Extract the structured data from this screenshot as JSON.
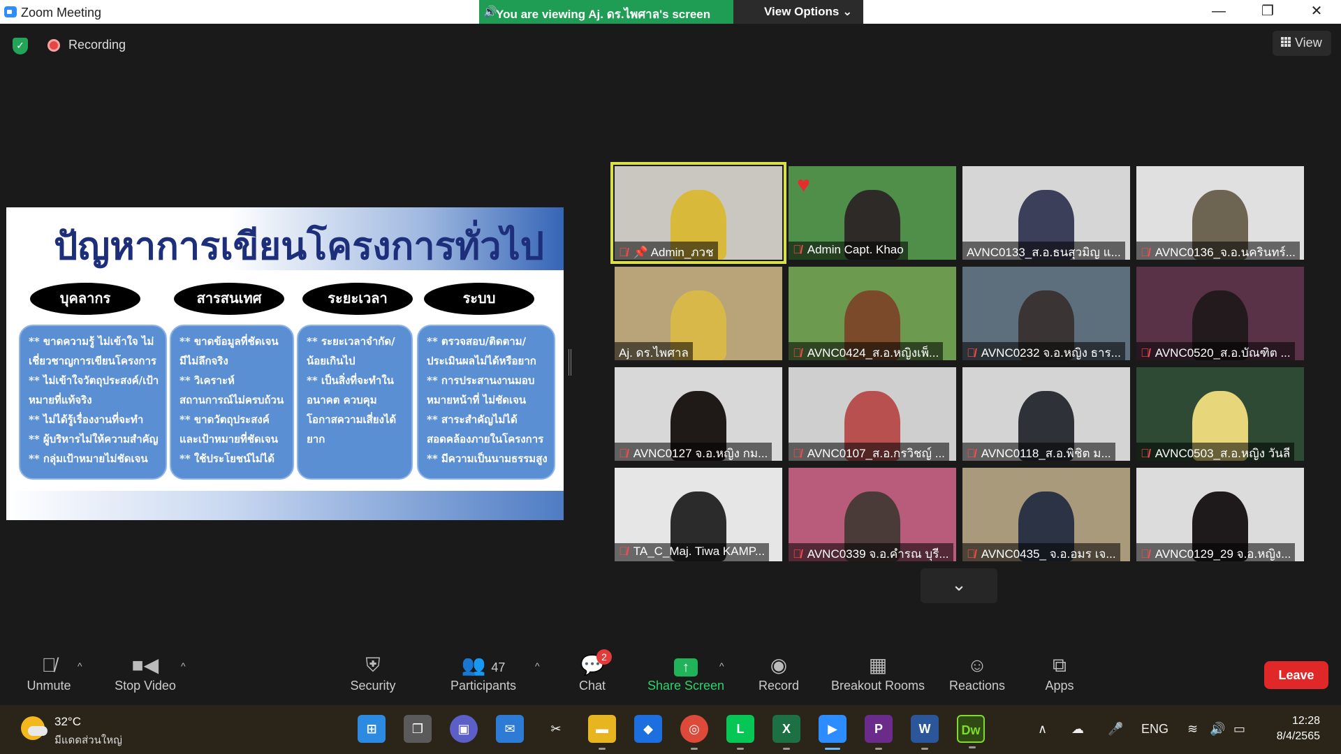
{
  "window": {
    "title": "Zoom Meeting",
    "minimize": "—",
    "maximize": "❐",
    "close": "✕"
  },
  "banner": {
    "viewing": "You are viewing Aj. ดร.ไพศาล's screen",
    "view_options": "View Options ⌄"
  },
  "meeting": {
    "recording_label": "Recording",
    "view_label": "View"
  },
  "slide": {
    "title": "ปัญหาการเขียนโครงการทั่วไป",
    "columns": [
      {
        "heading": "บุคลากร",
        "body": "** ขาดความรู้ ไม่เข้าใจ ไม่เชี่ยวชาญการเขียนโครงการ\n** ไม่เข้าใจวัตถุประสงค์/เป้าหมายที่แท้จริง\n** ไม่ได้รู้เรื่องงานที่จะทำ\n** ผู้บริหารไม่ให้ความสำคัญ\n** กลุ่มเป้าหมายไม่ชัดเจน"
      },
      {
        "heading": "สารสนเทศ",
        "body": "** ขาดข้อมูลที่ชัดเจน มีไม่ลึกจริง\n** วิเคราะห์สถานการณ์ไม่ครบถ้วน\n** ขาดวัตถุประสงค์และเป้าหมายที่ชัดเจน\n** ใช้ประโยชน์ไม่ได้"
      },
      {
        "heading": "ระยะเวลา",
        "body": "** ระยะเวลาจำกัด/น้อยเกินไป\n** เป็นสิ่งที่จะทำในอนาคต ควบคุมโอกาสความเสี่ยงได้ยาก"
      },
      {
        "heading": "ระบบ",
        "body": "** ตรวจสอบ/ติดตาม/ประเมินผลไม่ได้หรือยาก\n** การประสานงานมอบหมายหน้าที่ ไม่ชัดเจน\n** สาระสำคัญไม่ได้สอดคล้องภายในโครงการ\n** มีความเป็นนามธรรมสูง"
      }
    ]
  },
  "participants_tiles": [
    {
      "name": "Admin_ภวช",
      "muted": true,
      "pinned": true,
      "active": true,
      "bg": "#c9c7c0",
      "person": "#d8b93a"
    },
    {
      "name": "Admin Capt. Khao",
      "muted": true,
      "reaction": "♥",
      "bg": "#4f8f4a",
      "person": "#2e2a27"
    },
    {
      "name": "AVNC0133_ส.อ.ธนสุวมิญ  แ...",
      "muted": false,
      "bg": "#d6d6d6",
      "person": "#3b3f5a"
    },
    {
      "name": "AVNC0136_จ.อ.นครินทร์...",
      "muted": true,
      "bg": "#e0e0e0",
      "person": "#6d6452"
    },
    {
      "name": "Aj. ดร.ไพศาล",
      "muted": false,
      "bg": "#b9a47a",
      "person": "#d9b84a"
    },
    {
      "name": "AVNC0424_ส.อ.หญิงเพ็...",
      "muted": true,
      "bg": "#6c9a4e",
      "person": "#7a4a2a"
    },
    {
      "name": "AVNC0232 จ.อ.หญิง ธาร...",
      "muted": true,
      "bg": "#5d6f7d",
      "person": "#3a3534"
    },
    {
      "name": "AVNC0520_ส.อ.บัณฑิต ...",
      "muted": true,
      "bg": "#5a3247",
      "person": "#221a1c"
    },
    {
      "name": "AVNC0127 จ.อ.หญิง กม...",
      "muted": true,
      "bg": "#d8d8d8",
      "person": "#1f1a18"
    },
    {
      "name": "AVNC0107_ส.อ.กรวิชญ์ ...",
      "muted": true,
      "bg": "#cfcfcf",
      "person": "#b85050"
    },
    {
      "name": "AVNC0118_ส.อ.พิชิต ม...",
      "muted": true,
      "bg": "#d4d4d4",
      "person": "#2f3138"
    },
    {
      "name": "AVNC0503_ส.อ.หญิง วันลี",
      "muted": true,
      "bg": "#2e4a34",
      "person": "#e7d77a"
    },
    {
      "name": "TA_C_Maj. Tiwa KAMP...",
      "muted": true,
      "bg": "#e6e6e6",
      "person": "#2b2b2b"
    },
    {
      "name": "AVNC0339 จ.อ.คำรณ บุรี...",
      "muted": true,
      "bg": "#b95b7a",
      "person": "#4a3b39"
    },
    {
      "name": "AVNC0435_ จ.อ.อมร  เจ...",
      "muted": true,
      "bg": "#a89a7a",
      "person": "#2c3344"
    },
    {
      "name": "AVNC0129_29 จ.อ.หญิง...",
      "muted": true,
      "bg": "#dcdcdc",
      "person": "#1e1a1c"
    }
  ],
  "gallery": {
    "collapse_icon": "⌄"
  },
  "toolbar": {
    "unmute": "Unmute",
    "stop_video": "Stop Video",
    "security": "Security",
    "participants": "Participants",
    "participants_count": "47",
    "chat": "Chat",
    "chat_badge": "2",
    "share_screen": "Share Screen",
    "record": "Record",
    "breakout_rooms": "Breakout Rooms",
    "reactions": "Reactions",
    "apps": "Apps",
    "leave": "Leave"
  },
  "taskbar": {
    "temperature": "32°C",
    "weather": "มีแดดส่วนใหญ่",
    "language": "ENG",
    "time": "12:28",
    "date": "8/4/2565"
  },
  "colors": {
    "accent_green": "#23a559",
    "leave_red": "#e02828",
    "active_speaker": "#d9e04a"
  }
}
